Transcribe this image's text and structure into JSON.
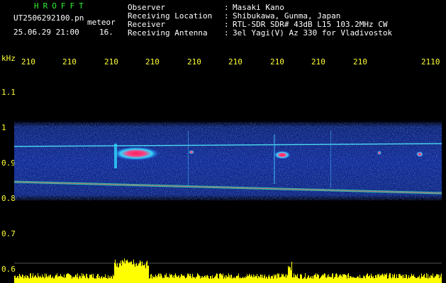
{
  "header": {
    "station": "HROFFT",
    "filename": "UT2506292100.pn",
    "meteor_word": "meteor",
    "datetime": "25.06.29 21:00",
    "count": "16.",
    "labels": [
      "Observer",
      "Receiving Location",
      "Receiver",
      "Receiving Antenna"
    ],
    "separator": ":",
    "values": [
      "Masaki Kano",
      "Shibukawa, Gunma, Japan",
      "RTL-SDR SDR# 43dB L15 103.2MHz CW",
      "3el Yagi(V) Az 330 for Vladivostok"
    ]
  },
  "axis": {
    "unit": "kHz",
    "minute_ticks": [
      "210",
      "210",
      "210",
      "210",
      "210",
      "210",
      "210",
      "210",
      "210",
      "2110"
    ],
    "freq_ticks": [
      "1.1",
      "1",
      "0.9",
      "0.8",
      "0.7",
      "0.6"
    ]
  },
  "colors": {
    "background": "#000000",
    "header_text": "#ffffff",
    "station_text": "#33ee33",
    "tick_text": "#ffff33",
    "signal_low": "#1b3fd8",
    "signal_mid": "#30d8ff",
    "signal_high": "#ff2060",
    "activity_bar": "#ffff00"
  }
}
